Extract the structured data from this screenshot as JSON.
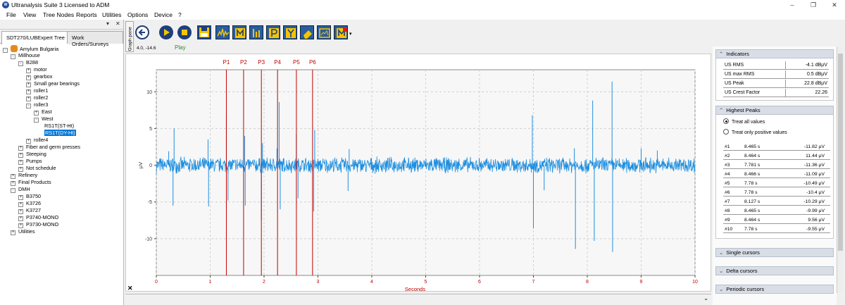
{
  "window": {
    "title": "Ultranalysis Suite 3 Licensed to ADM",
    "icon": "app-logo-icon",
    "controls": [
      "–",
      "❐",
      "✕"
    ]
  },
  "menu": [
    "File",
    "View",
    "Tree Nodes",
    "Reports",
    "Utilities",
    "Options",
    "Device",
    "?"
  ],
  "left_panel": {
    "controls": [
      "▾",
      "✕"
    ],
    "tabs": [
      "SDT270/LUBExpert Tree",
      "Work Orders/Surveys"
    ],
    "tree": [
      {
        "label": "Amylum Bulgaria",
        "level": 0,
        "exp": "-",
        "root": true
      },
      {
        "label": "Millhouse",
        "level": 1,
        "exp": "-"
      },
      {
        "label": "B288",
        "level": 2,
        "exp": "-"
      },
      {
        "label": "motor",
        "level": 3,
        "exp": "+"
      },
      {
        "label": "gearbox",
        "level": 3,
        "exp": "+"
      },
      {
        "label": "Small gear bearings",
        "level": 3,
        "exp": "+"
      },
      {
        "label": "roller1",
        "level": 3,
        "exp": "+"
      },
      {
        "label": "roller2",
        "level": 3,
        "exp": "+"
      },
      {
        "label": "roller3",
        "level": 3,
        "exp": "-"
      },
      {
        "label": "East",
        "level": 4,
        "exp": "+"
      },
      {
        "label": "West",
        "level": 4,
        "exp": "-"
      },
      {
        "label": "RS1T(ST-Ht)",
        "level": 5,
        "exp": ""
      },
      {
        "label": "RS1T(DY-Ht)",
        "level": 5,
        "exp": "",
        "selected": true
      },
      {
        "label": "roller4",
        "level": 3,
        "exp": "+"
      },
      {
        "label": "Fiber and germ presses",
        "level": 2,
        "exp": "+"
      },
      {
        "label": "Steeping",
        "level": 2,
        "exp": "+"
      },
      {
        "label": "Pumps",
        "level": 2,
        "exp": "+"
      },
      {
        "label": "Not schedule",
        "level": 2,
        "exp": "+"
      },
      {
        "label": "Refinery",
        "level": 1,
        "exp": "+"
      },
      {
        "label": "Final Products",
        "level": 1,
        "exp": "+"
      },
      {
        "label": "DMH",
        "level": 1,
        "exp": "-"
      },
      {
        "label": "B3750",
        "level": 2,
        "exp": "+"
      },
      {
        "label": "K3726",
        "level": 2,
        "exp": "+"
      },
      {
        "label": "K3727",
        "level": 2,
        "exp": "+"
      },
      {
        "label": "P3740-MONO",
        "level": 2,
        "exp": "+"
      },
      {
        "label": "P3730-MONO",
        "level": 2,
        "exp": "+"
      },
      {
        "label": "Utilities",
        "level": 1,
        "exp": "+"
      }
    ]
  },
  "graph": {
    "pane_tab": "Graph pane",
    "coords": "4.0, -14.6",
    "play_label": "Play",
    "close_label": "✕",
    "bottom_chevron": "⌄"
  },
  "chart_data": {
    "type": "line",
    "xlabel": "Seconds",
    "ylabel": "µV",
    "xlim": [
      0,
      10
    ],
    "ylim": [
      -15,
      13
    ],
    "xticks": [
      0,
      1,
      2,
      3,
      4,
      5,
      6,
      7,
      8,
      9,
      10
    ],
    "yticks": [
      -10,
      -5,
      0,
      5,
      10
    ],
    "grid": true,
    "series_color": "#1e8fe0",
    "cursor_color": "#c00000",
    "cursors": [
      {
        "label": "P1",
        "x": 1.3
      },
      {
        "label": "P2",
        "x": 1.62
      },
      {
        "label": "P3",
        "x": 1.95
      },
      {
        "label": "P4",
        "x": 2.25
      },
      {
        "label": "P5",
        "x": 2.6
      },
      {
        "label": "P6",
        "x": 2.9
      }
    ],
    "noise_amplitude": 1.0,
    "spikes": [
      {
        "x": 0.23,
        "y": 1.9
      },
      {
        "x": 0.33,
        "y": 5.0
      },
      {
        "x": 0.31,
        "y": -5.5
      },
      {
        "x": 0.97,
        "y": -5.6
      },
      {
        "x": 0.96,
        "y": 3.5
      },
      {
        "x": 1.3,
        "y": 6.4
      },
      {
        "x": 1.33,
        "y": -4.8
      },
      {
        "x": 1.64,
        "y": 4.0
      },
      {
        "x": 1.65,
        "y": -5.5
      },
      {
        "x": 1.95,
        "y": -7.4
      },
      {
        "x": 1.97,
        "y": 3.0
      },
      {
        "x": 2.28,
        "y": 8.6
      },
      {
        "x": 2.3,
        "y": -6.0
      },
      {
        "x": 2.24,
        "y": 2.3
      },
      {
        "x": 2.6,
        "y": 4.2
      },
      {
        "x": 2.63,
        "y": -4.5
      },
      {
        "x": 2.92,
        "y": -6.3
      },
      {
        "x": 2.94,
        "y": 4.8
      },
      {
        "x": 3.56,
        "y": -3.5
      },
      {
        "x": 3.58,
        "y": 2.2
      },
      {
        "x": 7.0,
        "y": -8.6
      },
      {
        "x": 6.98,
        "y": 6.8
      },
      {
        "x": 7.2,
        "y": -3.4
      },
      {
        "x": 7.78,
        "y": -11.4
      },
      {
        "x": 7.76,
        "y": 2.3
      },
      {
        "x": 8.13,
        "y": -10.3
      },
      {
        "x": 8.1,
        "y": 8.8
      },
      {
        "x": 8.46,
        "y": 11.4
      },
      {
        "x": 8.47,
        "y": -11.8
      },
      {
        "x": 9.0,
        "y": 2.3
      },
      {
        "x": 9.3,
        "y": 2.0
      }
    ]
  },
  "indicators": {
    "title": "Indicators",
    "rows": [
      {
        "label": "US RMS",
        "value": "-4.1 dBµV"
      },
      {
        "label": "US max RMS",
        "value": "0.5 dBµV"
      },
      {
        "label": "US Peak",
        "value": "22.8 dBµV"
      },
      {
        "label": "US Crest Factor",
        "value": "22.26"
      }
    ]
  },
  "highest_peaks": {
    "title": "Highest Peaks",
    "options": [
      "Treat all values",
      "Treat only positive values"
    ],
    "selected_option": 0,
    "rows": [
      {
        "n": "#1",
        "t": "8.465 s",
        "a": "-11.82 µV"
      },
      {
        "n": "#2",
        "t": "8.464 s",
        "a": "11.44 µV"
      },
      {
        "n": "#3",
        "t": "7.781 s",
        "a": "-11.36 µV"
      },
      {
        "n": "#4",
        "t": "8.466 s",
        "a": "-11.09 µV"
      },
      {
        "n": "#5",
        "t": "7.78 s",
        "a": "-10.49 µV"
      },
      {
        "n": "#6",
        "t": "7.78 s",
        "a": "-10.4 µV"
      },
      {
        "n": "#7",
        "t": "8.127 s",
        "a": "-10.29 µV"
      },
      {
        "n": "#8",
        "t": "8.465 s",
        "a": "-9.99 µV"
      },
      {
        "n": "#9",
        "t": "8.464 s",
        "a": "9.56 µV"
      },
      {
        "n": "#10",
        "t": "7.78 s",
        "a": "-9.55 µV"
      }
    ]
  },
  "collapsed_sections": [
    "Single cursors",
    "Delta cursors",
    "Periodic cursors"
  ]
}
